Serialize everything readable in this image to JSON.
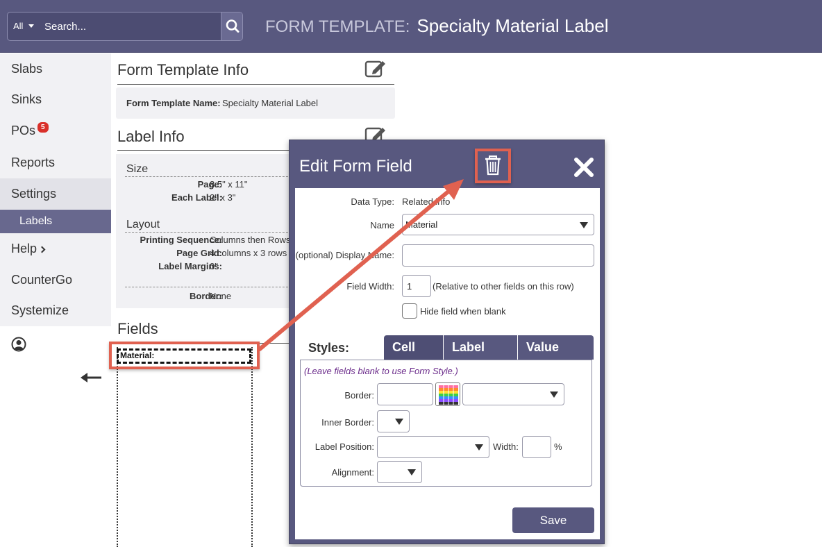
{
  "header": {
    "search_scope": "All",
    "search_placeholder": "Search...",
    "title_prefix": "FORM TEMPLATE:",
    "title": "Specialty Material Label"
  },
  "sidebar": {
    "items": [
      {
        "label": "Slabs"
      },
      {
        "label": "Sinks"
      },
      {
        "label": "POs",
        "badge": "5"
      },
      {
        "label": "Reports"
      },
      {
        "label": "Settings"
      },
      {
        "label": "Labels"
      },
      {
        "label": "Help"
      },
      {
        "label": "CounterGo"
      },
      {
        "label": "Systemize"
      }
    ]
  },
  "form_template_info": {
    "title": "Form Template Info",
    "name_label": "Form Template Name:",
    "name_value": "Specialty Material Label"
  },
  "label_info": {
    "title": "Label Info",
    "size_title": "Size",
    "page_label": "Page:",
    "page_value": "8.5\" x 11\"",
    "each_label_label": "Each Label:",
    "each_label_value": "2\" x 3\"",
    "layout_title": "Layout",
    "printing_sequence_label": "Printing Sequence:",
    "printing_sequence_value": "Columns then Rows",
    "page_grid_label": "Page Grid:",
    "page_grid_value": "4 columns x 3 rows",
    "label_margins_label": "Label Margins:",
    "label_margins_value": "0\"",
    "border_label": "Border:",
    "border_value": "None"
  },
  "fields": {
    "title": "Fields",
    "preview_field_text": "Material:"
  },
  "modal": {
    "title": "Edit Form Field",
    "data_type_label": "Data Type:",
    "data_type_value": "Related info",
    "name_label": "Name",
    "name_value": "Material",
    "display_name_label": "(optional) Display Name:",
    "display_name_value": "",
    "field_width_label": "Field Width:",
    "field_width_value": "1",
    "field_width_hint": "(Relative to other fields on this row)",
    "hide_blank_label": "Hide field when blank",
    "styles_label": "Styles:",
    "tabs": [
      {
        "label": "Cell"
      },
      {
        "label": "Label"
      },
      {
        "label": "Value"
      }
    ],
    "styles_hint": "(Leave fields blank to use Form Style.)",
    "border_label": "Border:",
    "inner_border_label": "Inner Border:",
    "label_position_label": "Label Position:",
    "width_label": "Width:",
    "percent": "%",
    "alignment_label": "Alignment:",
    "save_label": "Save"
  },
  "colors": {
    "header_bg": "#58587f",
    "accent": "#58587f",
    "callout": "#e06150",
    "badge": "#d9302a"
  }
}
